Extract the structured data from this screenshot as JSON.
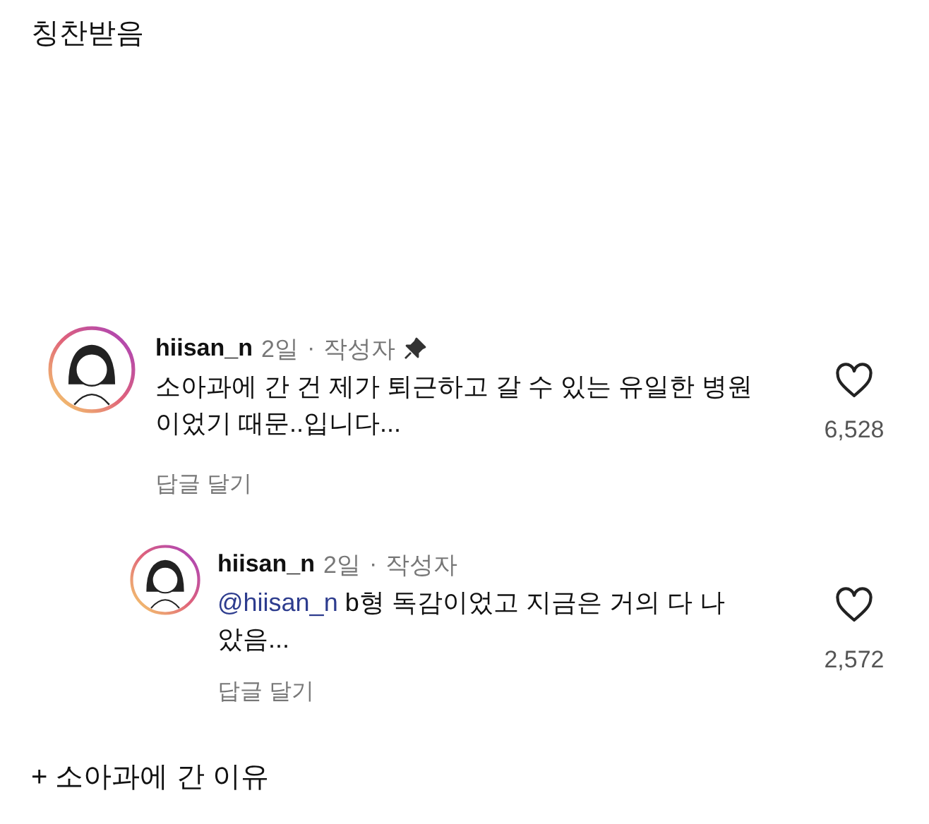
{
  "title": "칭찬받음",
  "comments": [
    {
      "username": "hiisan_n",
      "time": "2일",
      "separator": "·",
      "badge": "작성자",
      "pinned": true,
      "reply": false,
      "text": "소아과에 간 건 제가 퇴근하고 갈 수 있는 유일한 병원 이었기 때문..입니다...",
      "reply_link": "답글 달기",
      "liked": false,
      "likes": "6,528"
    },
    {
      "username": "hiisan_n",
      "time": "2일",
      "separator": "·",
      "badge": "작성자",
      "pinned": false,
      "reply": true,
      "mention": "@hiisan_n",
      "text": "b형 독감이었고 지금은 거의 다 나 았음...",
      "reply_link": "답글 달기",
      "liked": false,
      "likes": "2,572"
    }
  ],
  "footer": "+ 소아과에 간 이유"
}
